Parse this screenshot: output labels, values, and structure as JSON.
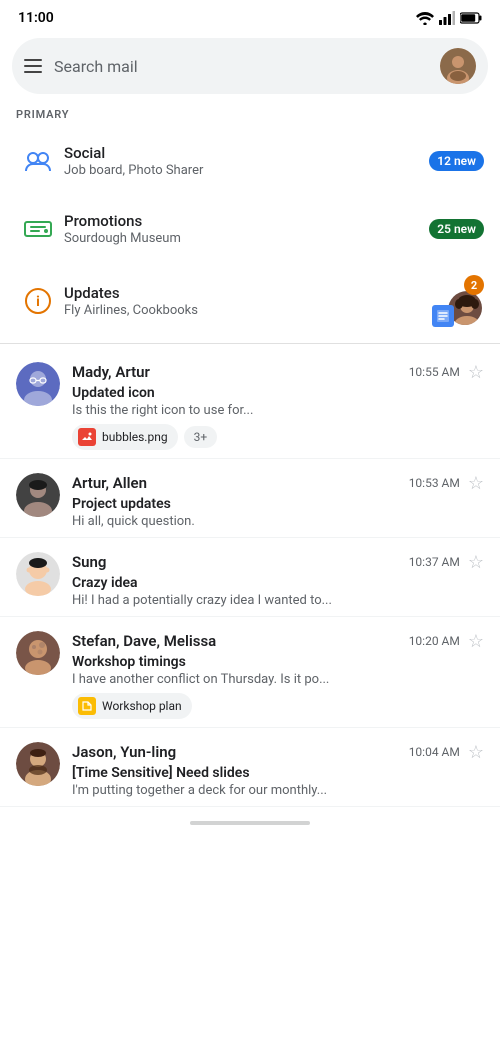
{
  "statusBar": {
    "time": "11:00"
  },
  "searchBar": {
    "placeholder": "Search mail"
  },
  "sectionLabel": "PRIMARY",
  "categories": [
    {
      "id": "social",
      "name": "Social",
      "sub": "Job board, Photo Sharer",
      "badge": "12 new",
      "badgeType": "blue",
      "icon": "social"
    },
    {
      "id": "promotions",
      "name": "Promotions",
      "sub": "Sourdough Museum",
      "badge": "25 new",
      "badgeType": "green",
      "icon": "promotions"
    },
    {
      "id": "updates",
      "name": "Updates",
      "sub": "Fly Airlines, Cookbooks",
      "badge": "2",
      "badgeType": "updates",
      "icon": "updates"
    }
  ],
  "emails": [
    {
      "id": 1,
      "sender": "Mady, Artur",
      "time": "10:55 AM",
      "subject": "Updated icon",
      "preview": "Is this the right icon to use for...",
      "avatar": "mady",
      "starred": false,
      "attachments": [
        {
          "name": "bubbles.png",
          "type": "image"
        }
      ],
      "moreCount": "3+"
    },
    {
      "id": 2,
      "sender": "Artur, Allen",
      "time": "10:53 AM",
      "subject": "Project updates",
      "preview": "Hi all, quick question.",
      "avatar": "artur",
      "starred": false,
      "attachments": []
    },
    {
      "id": 3,
      "sender": "Sung",
      "time": "10:37 AM",
      "subject": "Crazy idea",
      "preview": "Hi! I had a potentially crazy idea I wanted to...",
      "avatar": "sung",
      "starred": false,
      "attachments": []
    },
    {
      "id": 4,
      "sender": "Stefan, Dave, Melissa",
      "time": "10:20 AM",
      "subject": "Workshop timings",
      "preview": "I have another conflict on Thursday. Is it po...",
      "avatar": "stefan",
      "starred": false,
      "attachments": [
        {
          "name": "Workshop plan",
          "type": "doc"
        }
      ]
    },
    {
      "id": 5,
      "sender": "Jason, Yun-ling",
      "time": "10:04 AM",
      "subject": "[Time Sensitive] Need slides",
      "preview": "I'm putting together a deck for our monthly...",
      "avatar": "jason",
      "starred": false,
      "attachments": []
    }
  ],
  "icons": {
    "wifi": "wifi",
    "signal": "signal",
    "battery": "battery"
  }
}
